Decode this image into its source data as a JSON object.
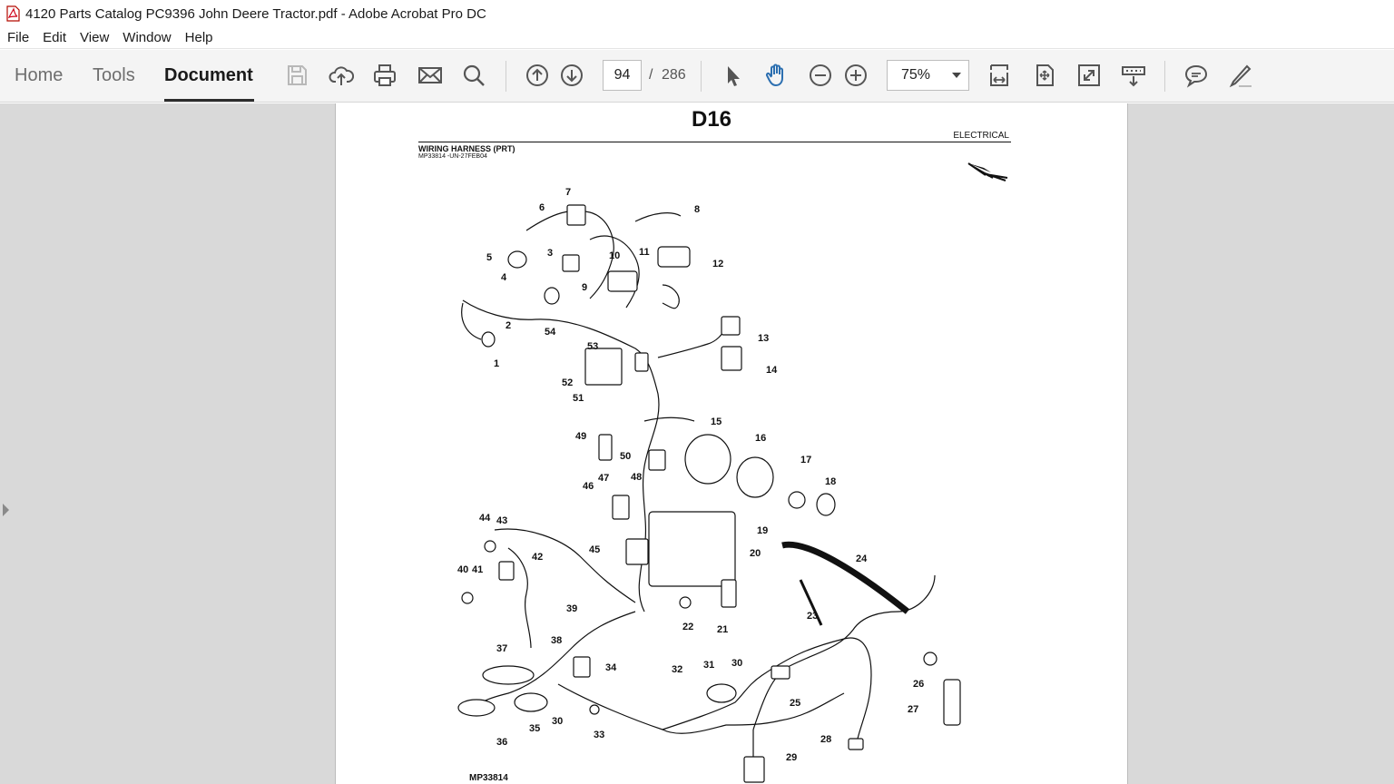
{
  "window": {
    "title": "4120 Parts Catalog PC9396 John Deere Tractor.pdf - Adobe Acrobat Pro DC"
  },
  "menu": [
    "File",
    "Edit",
    "View",
    "Window",
    "Help"
  ],
  "tabs": [
    "Home",
    "Tools",
    "Document"
  ],
  "active_tab": "Document",
  "toolbar": {
    "page_current": "94",
    "page_separator": "/",
    "page_total": "286",
    "zoom": "75%",
    "icons": [
      "save-icon",
      "cloud-upload-icon",
      "print-icon",
      "email-icon",
      "search-icon",
      "previous-page-icon",
      "next-page-icon",
      "select-arrow-icon",
      "hand-tool-icon",
      "zoom-out-icon",
      "zoom-in-icon",
      "fit-width-icon",
      "fit-page-icon",
      "full-screen-icon",
      "read-mode-icon",
      "comment-icon",
      "sign-pen-icon"
    ],
    "accent_color": "#2c6fb0"
  },
  "document": {
    "page_code": "D16",
    "section": "ELECTRICAL",
    "heading": "WIRING HARNESS (PRT)",
    "subheading": "MP33814       -UN-27FEB04",
    "figure_code": "MP33814",
    "callouts": [
      "1",
      "2",
      "3",
      "4",
      "5",
      "6",
      "7",
      "8",
      "9",
      "10",
      "11",
      "12",
      "13",
      "14",
      "15",
      "16",
      "17",
      "18",
      "19",
      "20",
      "21",
      "22",
      "23",
      "24",
      "25",
      "26",
      "27",
      "28",
      "29",
      "30",
      "30",
      "31",
      "32",
      "33",
      "34",
      "35",
      "36",
      "37",
      "38",
      "39",
      "40",
      "41",
      "42",
      "43",
      "44",
      "45",
      "46",
      "47",
      "48",
      "49",
      "50",
      "51",
      "52",
      "53",
      "54"
    ]
  }
}
